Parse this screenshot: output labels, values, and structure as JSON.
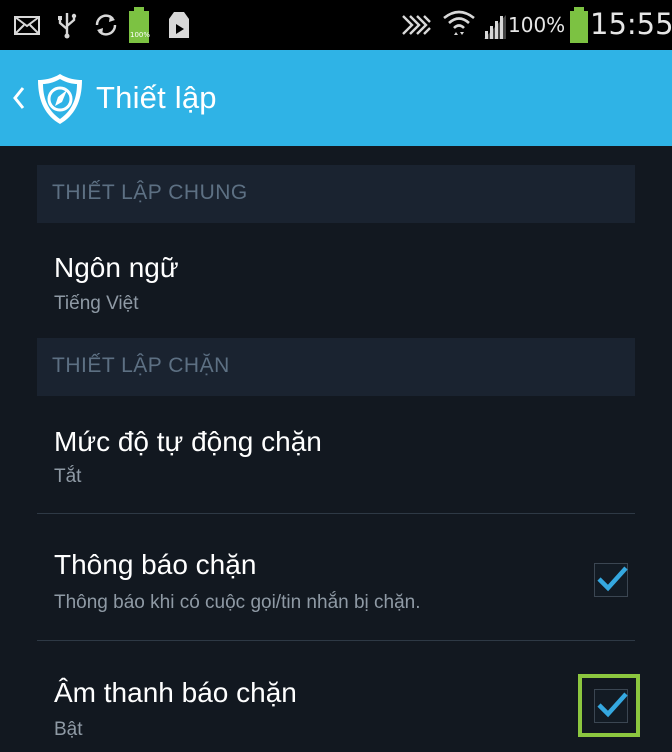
{
  "status_bar": {
    "battery_percent": "100%",
    "small_battery_label": "100%",
    "time": "15:55",
    "icons": [
      "mail-icon",
      "usb-icon",
      "sync-icon",
      "battery-small-icon",
      "download-icon",
      "nfc-icon",
      "wifi-icon",
      "signal-icon",
      "battery-icon"
    ]
  },
  "action_bar": {
    "title": "Thiết lập",
    "color": "#2fb3e6"
  },
  "sections": [
    {
      "header": "THIẾT LẬP CHUNG",
      "items": [
        {
          "title": "Ngôn ngữ",
          "summary": "Tiếng Việt"
        }
      ]
    },
    {
      "header": "THIẾT LẬP CHẶN",
      "items": [
        {
          "title": "Mức độ tự động chặn",
          "summary": "Tắt"
        },
        {
          "title": "Thông báo chặn",
          "summary": "Thông báo khi có cuộc gọi/tin nhắn bị chặn.",
          "checked": true
        },
        {
          "title": "Âm thanh báo chặn",
          "summary": "Bật",
          "checked": true
        }
      ]
    }
  ],
  "accent_color": "#35a8e0",
  "highlight_color": "#8cc63f"
}
